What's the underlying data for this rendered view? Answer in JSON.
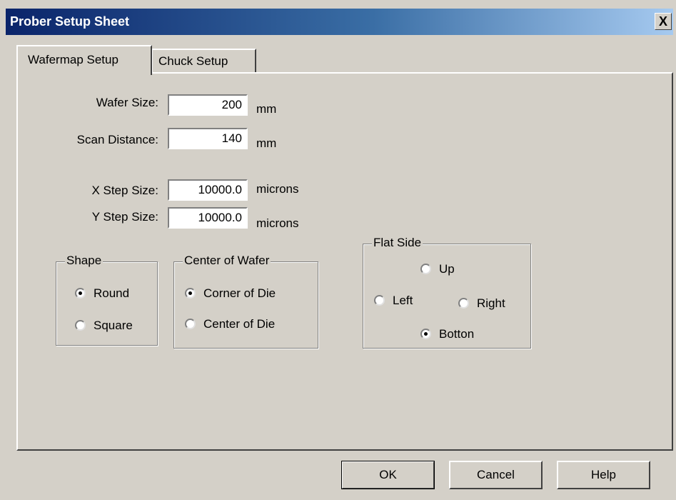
{
  "window": {
    "title": "Prober Setup Sheet",
    "close_glyph": "X"
  },
  "tabs": [
    {
      "label": "Wafermap Setup",
      "active": true
    },
    {
      "label": "Chuck Setup",
      "active": false
    }
  ],
  "fields": {
    "wafer_size": {
      "label": "Wafer Size:",
      "value": "200",
      "unit": "mm"
    },
    "scan_distance": {
      "label": "Scan Distance:",
      "value": "140",
      "unit": "mm"
    },
    "x_step": {
      "label": "X Step Size:",
      "value": "10000.0",
      "unit": "microns"
    },
    "y_step": {
      "label": "Y Step Size:",
      "value": "10000.0",
      "unit": "microns"
    }
  },
  "shape": {
    "legend": "Shape",
    "options": [
      "Round",
      "Square"
    ],
    "selected": "Round"
  },
  "center": {
    "legend": "Center of Wafer",
    "options": [
      "Corner of Die",
      "Center of Die"
    ],
    "selected": "Corner of Die"
  },
  "flat": {
    "legend": "Flat Side",
    "up": "Up",
    "left": "Left",
    "right": "Right",
    "bottom": "Botton",
    "selected": "Botton"
  },
  "buttons": {
    "ok": "OK",
    "cancel": "Cancel",
    "help": "Help"
  }
}
